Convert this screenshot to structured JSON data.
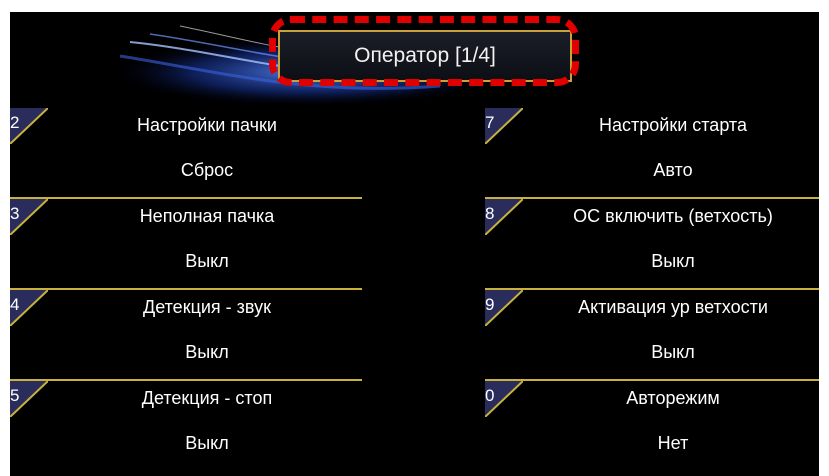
{
  "header": {
    "title": "Оператор [1/4]"
  },
  "left_items": [
    {
      "num": "2",
      "title": "Настройки пачки",
      "value": "Сброс"
    },
    {
      "num": "3",
      "title": "Неполная пачка",
      "value": "Выкл"
    },
    {
      "num": "4",
      "title": "Детекция - звук",
      "value": "Выкл"
    },
    {
      "num": "5",
      "title": "Детекция - стоп",
      "value": "Выкл"
    }
  ],
  "right_items": [
    {
      "num": "7",
      "title": "Настройки старта",
      "value": "Авто"
    },
    {
      "num": "8",
      "title": "ОС включить (ветхость)",
      "value": "Выкл"
    },
    {
      "num": "9",
      "title": "Активация ур ветхости",
      "value": "Выкл"
    },
    {
      "num": "0",
      "title": "Авторежим",
      "value": "Нет"
    }
  ],
  "colors": {
    "background": "#000000",
    "accent": "#c9b23c",
    "highlight": "#e00000",
    "tab": "#2a2d5c"
  }
}
